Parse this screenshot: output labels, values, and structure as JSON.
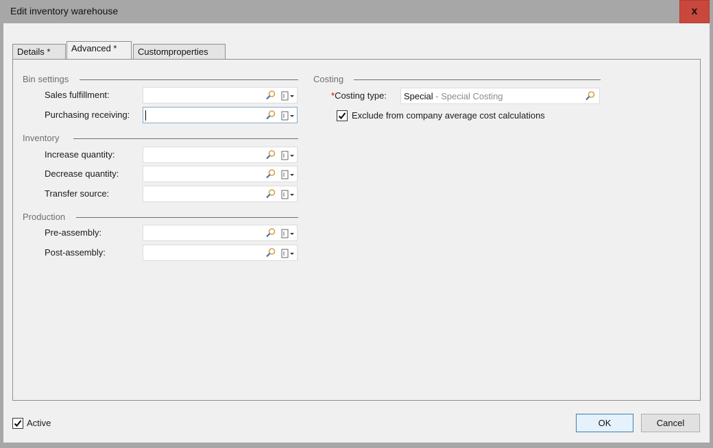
{
  "window": {
    "title": "Edit inventory warehouse",
    "close_label": "x"
  },
  "tabs": [
    {
      "label": "Details *",
      "active": false
    },
    {
      "label": "Advanced *",
      "active": true
    },
    {
      "label": "Customproperties",
      "active": false
    }
  ],
  "bin_settings": {
    "group_label": "Bin settings",
    "fields": [
      {
        "label": "Sales fulfillment:",
        "value": ""
      },
      {
        "label": "Purchasing receiving:",
        "value": "",
        "focused": true
      }
    ]
  },
  "inventory": {
    "group_label": "Inventory",
    "fields": [
      {
        "label": "Increase quantity:",
        "value": ""
      },
      {
        "label": "Decrease quantity:",
        "value": ""
      },
      {
        "label": "Transfer source:",
        "value": ""
      }
    ]
  },
  "production": {
    "group_label": "Production",
    "fields": [
      {
        "label": "Pre-assembly:",
        "value": ""
      },
      {
        "label": "Post-assembly:",
        "value": ""
      }
    ]
  },
  "costing": {
    "group_label": "Costing",
    "costing_type_required_mark": "*",
    "costing_type_label": "Costing type:",
    "costing_type_code": "Special",
    "costing_type_separator": " - ",
    "costing_type_description": "Special Costing",
    "exclude_label": "Exclude from company average cost calculations",
    "exclude_checked": true
  },
  "footer": {
    "active_label": "Active",
    "active_checked": true,
    "ok_label": "OK",
    "cancel_label": "Cancel"
  },
  "icons": {
    "search": "magnifier-icon",
    "dropdown": "document-dropdown-icon",
    "check": "checkmark-icon"
  },
  "colors": {
    "close_button": "#c9483d",
    "required": "#d40000",
    "group_label": "#6e6e6e",
    "ok_border": "#3c7fb1"
  }
}
